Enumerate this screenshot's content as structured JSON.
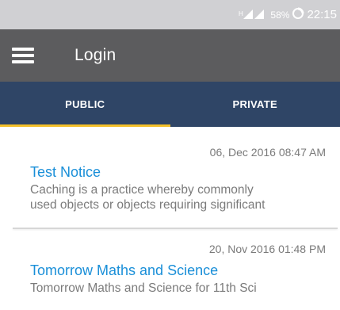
{
  "status_bar": {
    "battery": "58%",
    "time": "22:15"
  },
  "app_bar": {
    "title": "Login"
  },
  "tabs": [
    {
      "label": "PUBLIC",
      "active": true
    },
    {
      "label": "PRIVATE",
      "active": false
    }
  ],
  "notices": [
    {
      "date": "06, Dec 2016 08:47 AM",
      "title": "Test Notice",
      "desc_line1": "Caching is a practice whereby commonly",
      "desc_line2": "used objects or objects requiring significant"
    },
    {
      "date": "20, Nov 2016 01:48 PM",
      "title": "Tomorrow Maths and Science",
      "desc_line1": "Tomorrow Maths and Science for 11th Sci"
    }
  ],
  "colors": {
    "status_bar": "#d0d0d3",
    "app_bar": "#5c5c5e",
    "tab_bar": "#2f4566",
    "tab_indicator": "#f4c02a",
    "notice_title": "#1a8fd8"
  }
}
